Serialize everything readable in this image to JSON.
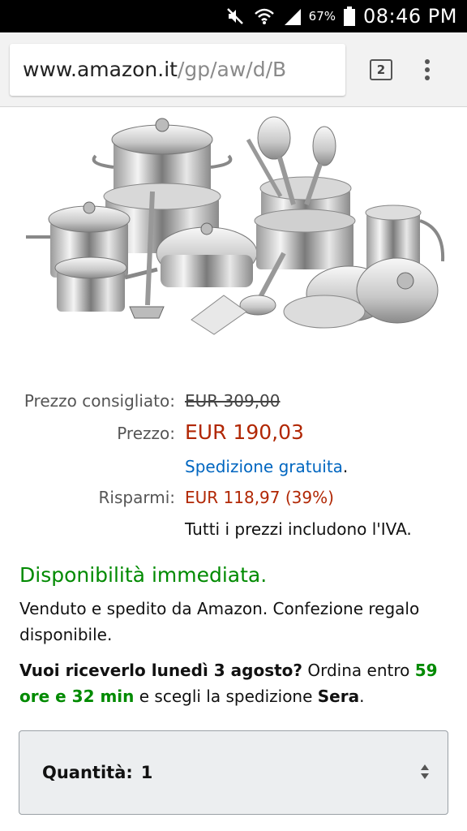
{
  "status_bar": {
    "icons": [
      "mute-icon",
      "wifi-icon",
      "signal-icon"
    ],
    "battery_pct": "67%",
    "time": "08:46 PM"
  },
  "browser": {
    "url_host": "www.amazon.it",
    "url_path": "/gp/aw/d/B",
    "tab_count": "2"
  },
  "product": {
    "image_alt": "stainless steel cookware set"
  },
  "pricing": {
    "list_label": "Prezzo consigliato:",
    "list_value": "EUR 309,00",
    "price_label": "Prezzo:",
    "price_value": "EUR 190,03",
    "shipping_link": "Spedizione gratuita",
    "shipping_period": ".",
    "savings_label": "Risparmi:",
    "savings_value": "EUR 118,97 (39%)",
    "vat_note": "Tutti i prezzi includono l'IVA."
  },
  "availability": "Disponibilità immediata.",
  "seller_text": "Venduto e spedito da Amazon. Confezione regalo disponibile.",
  "delivery": {
    "question": "Vuoi riceverlo lunedì 3 agosto?",
    "text1": " Ordina entro ",
    "countdown": "59 ore e 32 min",
    "text2": " e scegli la spedizione ",
    "option": "Sera",
    "end": "."
  },
  "quantity": {
    "label": "Quantità:",
    "value": "1"
  },
  "colors": {
    "price_red": "#b12704",
    "link_blue": "#0066c0",
    "stock_green": "#008a00"
  }
}
